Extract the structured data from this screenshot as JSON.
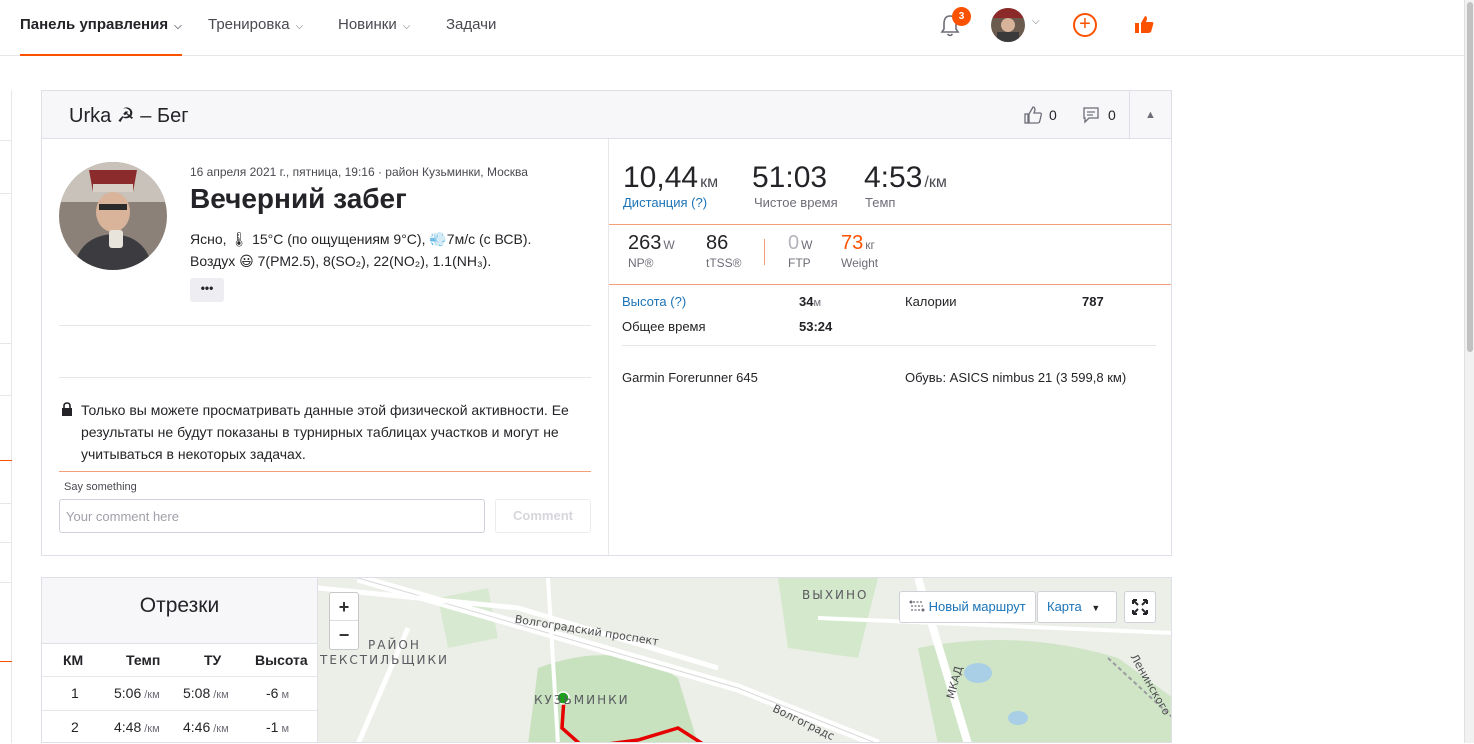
{
  "nav": {
    "items": [
      {
        "label": "Панель управления",
        "chevron": true
      },
      {
        "label": "Тренировка",
        "chevron": true
      },
      {
        "label": "Новинки",
        "chevron": true
      },
      {
        "label": "Задачи",
        "chevron": false
      }
    ],
    "notifications_count": "3",
    "accent_color": "#fc5200"
  },
  "activity": {
    "title": "Urka ☭ – Бег",
    "kudos_count": "0",
    "comments_count": "0",
    "meta": "16 апреля 2021 г., пятница, 19:16 · район Кузьминки, Москва",
    "name": "Вечерний забег",
    "weather_line1": "Ясно, 🌡 15°C (по ощущениям 9°C), 💨7м/с (с ВСВ).",
    "weather_line2": "Воздух 😃 7(PM2.5), 8(SO₂), 22(NO₂), 1.1(NH₃).",
    "more_label": "•••",
    "privacy_text": "Только вы можете просматривать данные этой физической активности. Ее результаты не будут показаны в турнирных таблицах участков и могут не учитываться в некоторых задачах.",
    "say_label": "Say something",
    "comment_placeholder": "Your comment here",
    "comment_button": "Comment"
  },
  "stats": {
    "distance": {
      "value": "10,44",
      "unit": "км",
      "label": "Дистанция (?)"
    },
    "moving_time": {
      "value": "51:03",
      "label": "Чистое время"
    },
    "pace": {
      "value": "4:53",
      "unit": "/км",
      "label": "Темп"
    },
    "np": {
      "value": "263",
      "unit": "W",
      "label": "NP®"
    },
    "tss": {
      "value": "86",
      "label": "tTSS®"
    },
    "ftp": {
      "value": "0",
      "unit": "W",
      "label": "FTP"
    },
    "weight": {
      "value": "73",
      "unit": "кг",
      "label": "Weight"
    },
    "elevation": {
      "label": "Высота (?)",
      "value": "34",
      "unit": "м"
    },
    "calories": {
      "label": "Калории",
      "value": "787"
    },
    "elapsed": {
      "label": "Общее время",
      "value": "53:24"
    },
    "device": "Garmin Forerunner 645",
    "shoes": "Обувь: ASICS nimbus 21 (3 599,8 км)"
  },
  "segments": {
    "title": "Отрезки",
    "headers": [
      "КМ",
      "Темп",
      "ТУ",
      "Высота"
    ],
    "rows": [
      {
        "km": "1",
        "pace": "5:06",
        "pace_unit": "/км",
        "gap": "5:08",
        "gap_unit": "/км",
        "elev": "-6",
        "elev_unit": "м"
      },
      {
        "km": "2",
        "pace": "4:48",
        "pace_unit": "/км",
        "gap": "4:46",
        "gap_unit": "/км",
        "elev": "-1",
        "elev_unit": "м"
      }
    ]
  },
  "map": {
    "labels": {
      "vykhino": "ВЫХИНО",
      "rayon": "РАЙОН",
      "tekstilshchiki": "ТЕКСТИЛЬЩИКИ",
      "kuzminki": "КУЗЬМИНКИ",
      "volgogradsky": "Волгоградский проспект",
      "volgograd2": "Волгоградс",
      "mkad": "МКАД",
      "leninsky": "Ленинского"
    },
    "zoom_in": "+",
    "zoom_out": "−",
    "new_route": "Новый маршрут",
    "map_type": "Карта"
  }
}
